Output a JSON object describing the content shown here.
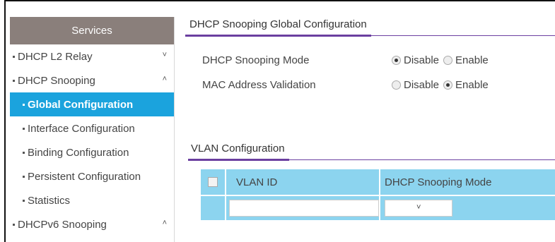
{
  "sidebar": {
    "header": "Services",
    "items": [
      {
        "label": "DHCP L2 Relay",
        "level": 1,
        "chevron": "down"
      },
      {
        "label": "DHCP Snooping",
        "level": 1,
        "chevron": "up"
      },
      {
        "label": "Global Configuration",
        "level": 2,
        "active": true
      },
      {
        "label": "Interface Configuration",
        "level": 2
      },
      {
        "label": "Binding Configuration",
        "level": 2
      },
      {
        "label": "Persistent Configuration",
        "level": 2
      },
      {
        "label": "Statistics",
        "level": 2
      },
      {
        "label": "DHCPv6 Snooping",
        "level": 1,
        "chevron": "up"
      }
    ]
  },
  "global_config": {
    "title": "DHCP Snooping Global Configuration",
    "rows": [
      {
        "label": "DHCP Snooping Mode",
        "options": [
          "Disable",
          "Enable"
        ],
        "selected": "Disable"
      },
      {
        "label": "MAC Address Validation",
        "options": [
          "Disable",
          "Enable"
        ],
        "selected": "Enable"
      }
    ]
  },
  "vlan_config": {
    "title": "VLAN Configuration",
    "columns": {
      "vlan_id": "VLAN ID",
      "mode": "DHCP Snooping Mode"
    },
    "input_value": "",
    "select_value": ""
  },
  "colors": {
    "sidebar_header": "#8a7f7b",
    "active_item": "#1ba3dd",
    "table_bg": "#8cd4ef",
    "accent_line": "#6b3fa0"
  },
  "icons": {
    "chevron_down": "˅",
    "chevron_up": "˄"
  }
}
